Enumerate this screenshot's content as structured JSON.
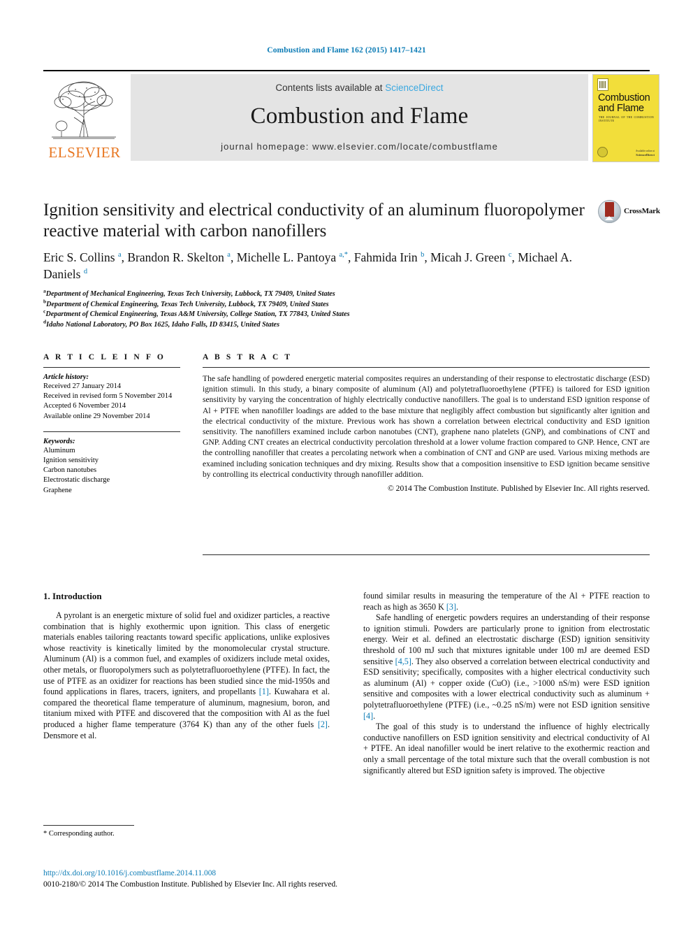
{
  "running_head": "Combustion and Flame 162 (2015) 1417–1421",
  "masthead": {
    "contents_prefix": "Contents lists available at",
    "sciencedirect": "ScienceDirect",
    "journal_title": "Combustion and Flame",
    "journal_homepage": "journal homepage: www.elsevier.com/locate/combustflame",
    "publisher_name": "ELSEVIER",
    "cover": {
      "title": "Combustion and Flame",
      "subtitle": "THE JOURNAL OF THE COMBUSTION INSTITUTE",
      "foot_small": "Available online at",
      "foot_brand": "ScienceDirect"
    },
    "sciencedirect_color": "#3ba8e0",
    "elsevier_orange": "#e87722",
    "cover_yellow": "#f2de3a"
  },
  "article": {
    "title": "Ignition sensitivity and electrical conductivity of an aluminum fluoropolymer reactive material with carbon nanofillers",
    "crossmark_label": "CrossMark",
    "authors_html": "Eric S. Collins <sup>a</sup>, Brandon R. Skelton <sup>a</sup>, Michelle L. Pantoya <sup>a,*</sup>, Fahmida Irin <sup>b</sup>, Micah J. Green <sup>c</sup>, Michael A. Daniels <sup>d</sup>",
    "affiliations": [
      {
        "marker": "a",
        "text": "Department of Mechanical Engineering, Texas Tech University, Lubbock, TX 79409, United States"
      },
      {
        "marker": "b",
        "text": "Department of Chemical Engineering, Texas Tech University, Lubbock, TX 79409, United States"
      },
      {
        "marker": "c",
        "text": "Department of Chemical Engineering, Texas A&M University, College Station, TX 77843, United States"
      },
      {
        "marker": "d",
        "text": "Idaho National Laboratory, PO Box 1625, Idaho Falls, ID 83415, United States"
      }
    ]
  },
  "article_info": {
    "heading": "A R T I C L E  I N F O",
    "history_label": "Article history:",
    "history": [
      "Received 27 January 2014",
      "Received in revised form 5 November 2014",
      "Accepted 6 November 2014",
      "Available online 29 November 2014"
    ],
    "keywords_label": "Keywords:",
    "keywords": [
      "Aluminum",
      "Ignition sensitivity",
      "Carbon nanotubes",
      "Electrostatic discharge",
      "Graphene"
    ]
  },
  "abstract": {
    "heading": "A B S T R A C T",
    "text": "The safe handling of powdered energetic material composites requires an understanding of their response to electrostatic discharge (ESD) ignition stimuli. In this study, a binary composite of aluminum (Al) and polytetrafluoroethylene (PTFE) is tailored for ESD ignition sensitivity by varying the concentration of highly electrically conductive nanofillers. The goal is to understand ESD ignition response of Al + PTFE when nanofiller loadings are added to the base mixture that negligibly affect combustion but significantly alter ignition and the electrical conductivity of the mixture. Previous work has shown a correlation between electrical conductivity and ESD ignition sensitivity. The nanofillers examined include carbon nanotubes (CNT), graphene nano platelets (GNP), and combinations of CNT and GNP. Adding CNT creates an electrical conductivity percolation threshold at a lower volume fraction compared to GNP. Hence, CNT are the controlling nanofiller that creates a percolating network when a combination of CNT and GNP are used. Various mixing methods are examined including sonication techniques and dry mixing. Results show that a composition insensitive to ESD ignition became sensitive by controlling its electrical conductivity through nanofiller addition.",
    "copyright": "© 2014 The Combustion Institute. Published by Elsevier Inc. All rights reserved."
  },
  "body": {
    "section_title": "1. Introduction",
    "left_paragraphs": [
      "A pyrolant is an energetic mixture of solid fuel and oxidizer particles, a reactive combination that is highly exothermic upon ignition. This class of energetic materials enables tailoring reactants toward specific applications, unlike explosives whose reactivity is kinetically limited by the monomolecular crystal structure. Aluminum (Al) is a common fuel, and examples of oxidizers include metal oxides, other metals, or fluoropolymers such as polytetrafluoroethylene (PTFE). In fact, the use of PTFE as an oxidizer for reactions has been studied since the mid-1950s and found applications in flares, tracers, igniters, and propellants [1]. Kuwahara et al. compared the theoretical flame temperature of aluminum, magnesium, boron, and titanium mixed with PTFE and discovered that the composition with Al as the fuel produced a higher flame temperature (3764 K) than any of the other fuels [2]. Densmore et al."
    ],
    "right_paragraphs": [
      "found similar results in measuring the temperature of the Al + PTFE reaction to reach as high as 3650 K [3].",
      "Safe handling of energetic powders requires an understanding of their response to ignition stimuli. Powders are particularly prone to ignition from electrostatic energy. Weir et al. defined an electrostatic discharge (ESD) ignition sensitivity threshold of 100 mJ such that mixtures ignitable under 100 mJ are deemed ESD sensitive [4,5]. They also observed a correlation between electrical conductivity and ESD sensitivity; specifically, composites with a higher electrical conductivity such as aluminum (Al) + copper oxide (CuO) (i.e., >1000 nS/m) were ESD ignition sensitive and composites with a lower electrical conductivity such as aluminum + polytetrafluoroethylene (PTFE) (i.e., ~0.25 nS/m) were not ESD ignition sensitive [4].",
      "The goal of this study is to understand the influence of highly electrically conductive nanofillers on ESD ignition sensitivity and electrical conductivity of Al + PTFE. An ideal nanofiller would be inert relative to the exothermic reaction and only a small percentage of the total mixture such that the overall combustion is not significantly altered but ESD ignition safety is improved. The objective"
    ]
  },
  "footer": {
    "corresponding_author": "* Corresponding author.",
    "doi": "http://dx.doi.org/10.1016/j.combustflame.2014.11.008",
    "issn_line": "0010-2180/© 2014 The Combustion Institute. Published by Elsevier Inc. All rights reserved.",
    "link_color": "#0b7bb5"
  }
}
